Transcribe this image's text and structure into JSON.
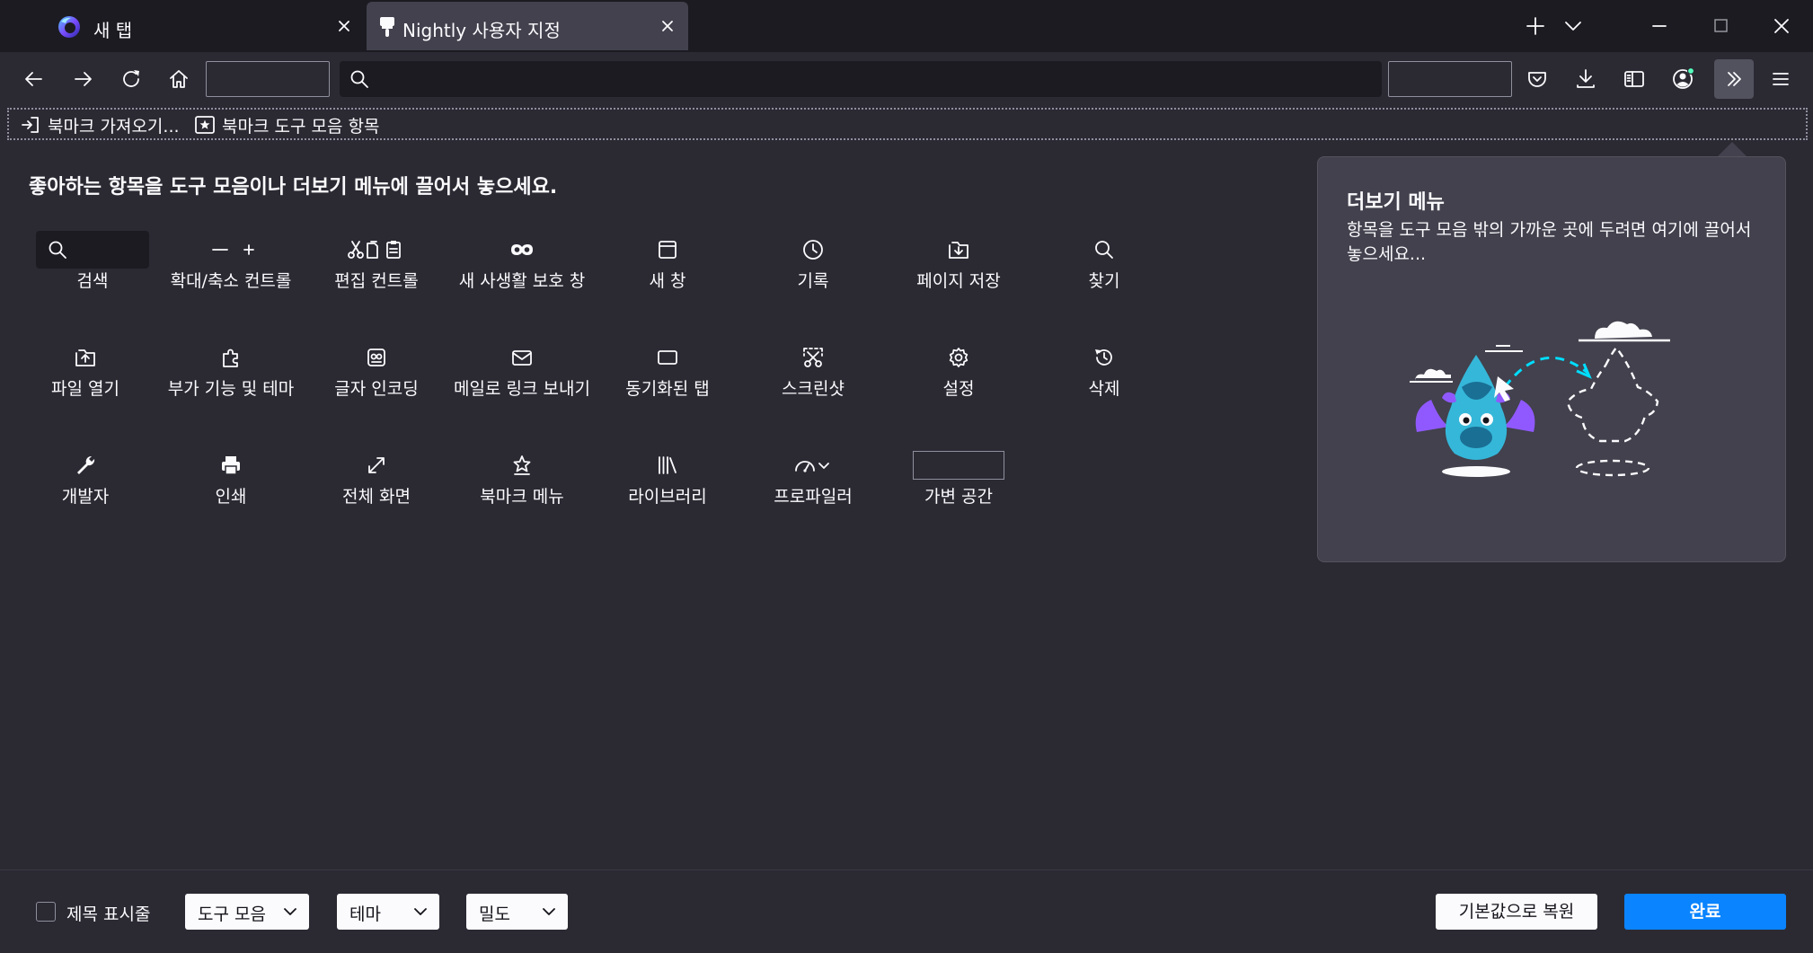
{
  "tabs": [
    {
      "title": "새 탭"
    },
    {
      "title": "Nightly 사용자 지정"
    }
  ],
  "instructions": "좋아하는 항목을 도구 모음이나 더보기 메뉴에 끌어서 놓으세요.",
  "bookmarks": {
    "import_label": "북마크 가져오기...",
    "toolbar_items_label": "북마크 도구 모음 항목"
  },
  "palette": [
    {
      "label": "검색",
      "icon": "search-icon"
    },
    {
      "label": "확대/축소 컨트롤",
      "icon": "zoom-controls-icon"
    },
    {
      "label": "편집 컨트롤",
      "icon": "edit-controls-icon"
    },
    {
      "label": "새 사생활 보호 창",
      "icon": "private-window-icon"
    },
    {
      "label": "새 창",
      "icon": "window-icon"
    },
    {
      "label": "기록",
      "icon": "clock-icon"
    },
    {
      "label": "페이지 저장",
      "icon": "save-page-icon"
    },
    {
      "label": "찾기",
      "icon": "find-icon"
    },
    {
      "label": "파일 열기",
      "icon": "open-file-icon"
    },
    {
      "label": "부가 기능 및 테마",
      "icon": "puzzle-icon"
    },
    {
      "label": "글자 인코딩",
      "icon": "text-encoding-icon"
    },
    {
      "label": "메일로 링크 보내기",
      "icon": "mail-icon"
    },
    {
      "label": "동기화된 탭",
      "icon": "synced-tabs-icon"
    },
    {
      "label": "스크린샷",
      "icon": "screenshot-icon"
    },
    {
      "label": "설정",
      "icon": "gear-icon"
    },
    {
      "label": "삭제",
      "icon": "forget-icon"
    },
    {
      "label": "개발자",
      "icon": "wrench-icon"
    },
    {
      "label": "인쇄",
      "icon": "printer-icon"
    },
    {
      "label": "전체 화면",
      "icon": "fullscreen-icon"
    },
    {
      "label": "북마크 메뉴",
      "icon": "bookmark-menu-icon"
    },
    {
      "label": "라이브러리",
      "icon": "library-icon"
    },
    {
      "label": "프로파일러",
      "icon": "profiler-icon"
    },
    {
      "label": "가변 공간",
      "icon": "flexible-space-icon"
    }
  ],
  "overflow_panel": {
    "title": "더보기 메뉴",
    "description": "항목을 도구 모음 밖의 가까운 곳에 두려면 여기에 끌어서 놓으세요..."
  },
  "footer": {
    "titlebar_label": "제목 표시줄",
    "toolbars_label": "도구 모음",
    "themes_label": "테마",
    "density_label": "밀도",
    "reset_label": "기본값으로 복원",
    "done_label": "완료"
  },
  "colors": {
    "background": "#2b2a33",
    "tabstrip": "#1c1b22",
    "selected_tab": "#42414d",
    "accent": "#0a84ff",
    "text": "#fbfbfe",
    "panel": "#42414d"
  }
}
